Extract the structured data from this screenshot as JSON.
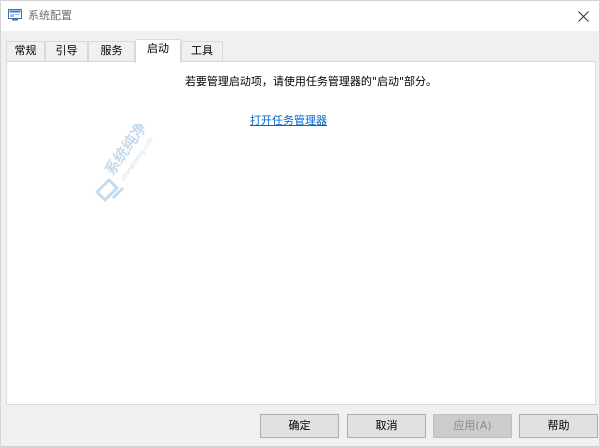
{
  "window": {
    "title": "系统配置",
    "icon": "msconfig-icon",
    "close_icon": "close-icon"
  },
  "tabs": [
    {
      "label": "常规",
      "active": false
    },
    {
      "label": "引导",
      "active": false
    },
    {
      "label": "服务",
      "active": false
    },
    {
      "label": "启动",
      "active": true
    },
    {
      "label": "工具",
      "active": false
    }
  ],
  "startup_panel": {
    "instruction": "若要管理启动项，请使用任务管理器的\"启动\"部分。",
    "link_label": "打开任务管理器"
  },
  "watermark": {
    "main_text": "系统纯净",
    "sub_text": "xitongcheng.com"
  },
  "buttons": {
    "ok": "确定",
    "cancel": "取消",
    "apply": "应用(A)",
    "help": "帮助"
  },
  "colors": {
    "link": "#0066cc",
    "window_bg": "#f0f0f0",
    "panel_bg": "#ffffff",
    "watermark": "#2f7fc1"
  }
}
